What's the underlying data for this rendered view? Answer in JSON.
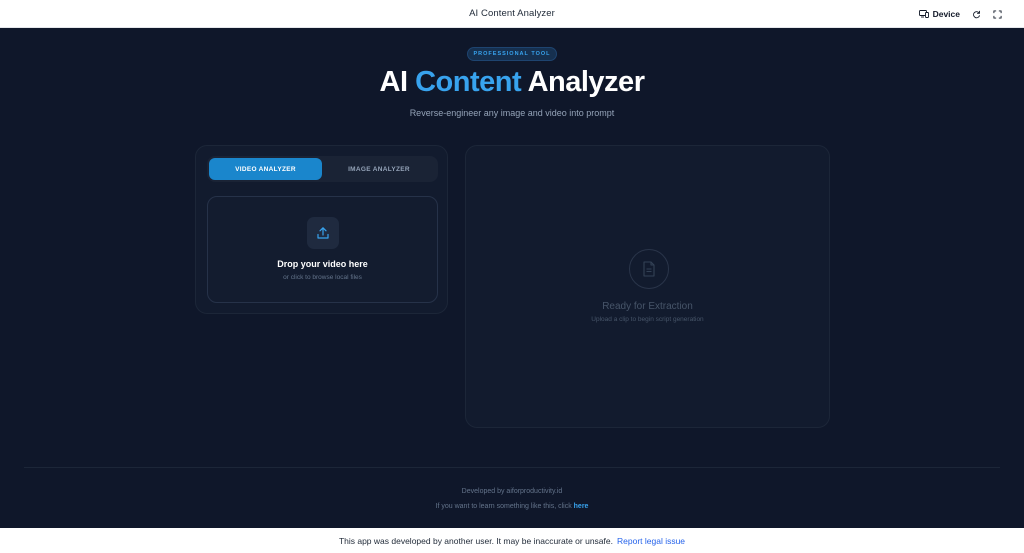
{
  "topbar": {
    "title": "AI Content Analyzer",
    "device_label": "Device"
  },
  "hero": {
    "badge": "PROFESSIONAL TOOL",
    "title_part1": "AI ",
    "title_accent": "Content",
    "title_part2": " Analyzer",
    "subtitle": "Reverse-engineer any image and video into prompt"
  },
  "tabs": [
    {
      "label": "VIDEO ANALYZER",
      "active": true
    },
    {
      "label": "IMAGE ANALYZER",
      "active": false
    }
  ],
  "dropzone": {
    "title": "Drop your video here",
    "subtitle": "or click to browse local files"
  },
  "output": {
    "title": "Ready for Extraction",
    "subtitle": "Upload a clip to begin script generation"
  },
  "footer": {
    "developed_by": "Developed by aiforproductivity.id",
    "learn_prefix": "If you want to learn something like this, click ",
    "learn_link": "here"
  },
  "bottombar": {
    "notice": "This app was developed by another user. It may be inaccurate or unsafe.",
    "legal_link": "Report legal issue"
  },
  "colors": {
    "background": "#0f172a",
    "card": "#121b2e",
    "accent": "#38a3ee",
    "active_tab": "#1a86cc"
  },
  "icons": [
    "device-icon",
    "refresh-icon",
    "fullscreen-icon",
    "upload-icon",
    "document-icon"
  ]
}
